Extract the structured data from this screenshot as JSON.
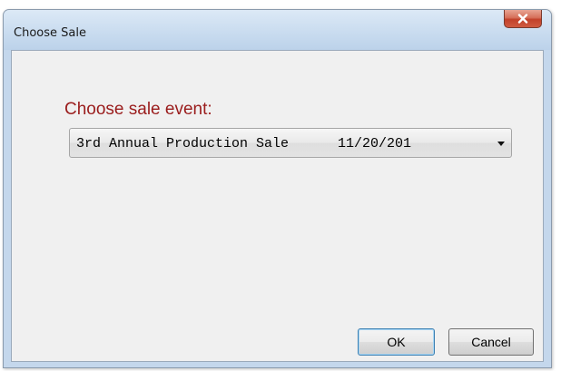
{
  "window": {
    "title": "Choose Sale"
  },
  "dialog": {
    "prompt": "Choose sale event:",
    "sale_select": {
      "selected_value": "3rd Annual Production Sale      11/20/201"
    },
    "ok_label": "OK",
    "cancel_label": "Cancel"
  },
  "icons": {
    "close": "close-icon",
    "dropdown": "chevron-down-icon"
  },
  "colors": {
    "prompt_text": "#9a1c1c",
    "close_button": "#c2412a",
    "window_frame": "#c4d7ec",
    "client_background": "#f0f0f0"
  }
}
